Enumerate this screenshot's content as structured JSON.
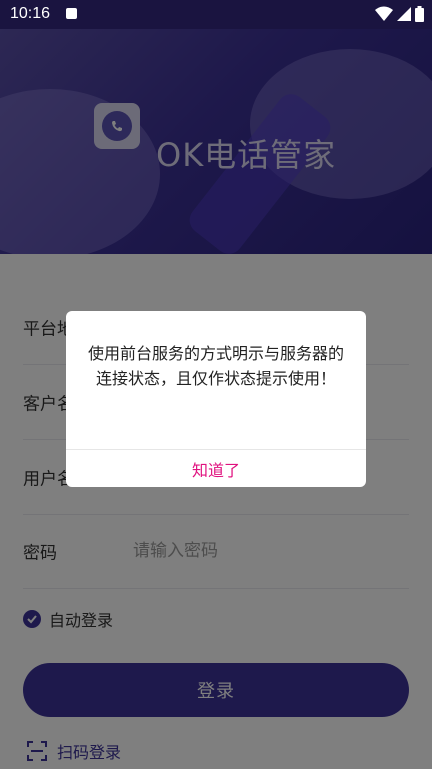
{
  "status_bar": {
    "time": "10:16",
    "icons": [
      "notification-a-icon",
      "wifi-icon",
      "signal-icon",
      "battery-icon"
    ]
  },
  "header": {
    "app_name": "OK电话管家",
    "logo_icon": "phone-chat-icon"
  },
  "form": {
    "fields": [
      {
        "label": "平台地址",
        "value": "",
        "placeholder": ""
      },
      {
        "label": "客户名",
        "value": "",
        "placeholder": ""
      },
      {
        "label": "用户名",
        "value": "",
        "placeholder": ""
      },
      {
        "label": "密码",
        "value": "",
        "placeholder": "请输入密码"
      }
    ],
    "auto_login": {
      "label": "自动登录",
      "checked": true
    },
    "login_button": "登录",
    "scan_login": "扫码登录"
  },
  "dialog": {
    "message": "使用前台服务的方式明示与服务器的连接状态，且仅作状态提示使用！",
    "confirm_button": "知道了"
  },
  "colors": {
    "primary": "#3d3399",
    "dialog_button": "#e0117f"
  }
}
